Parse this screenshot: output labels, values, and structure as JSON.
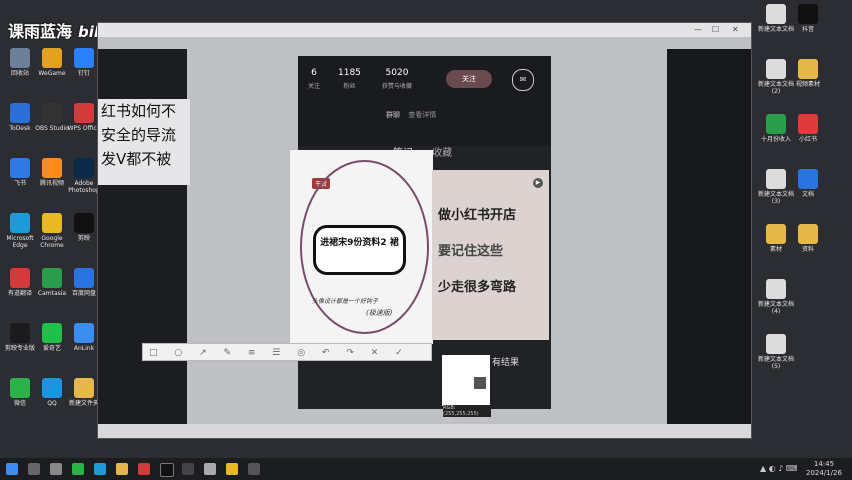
{
  "watermark": {
    "text": "课雨蓝海",
    "brand": "bilibili"
  },
  "window": {
    "title": "",
    "controls": [
      "—",
      "☐",
      "✕"
    ]
  },
  "profile": {
    "stats": [
      {
        "value": "6",
        "label": "关注"
      },
      {
        "value": "1185",
        "label": "粉丝"
      },
      {
        "value": "5020",
        "label": "获赞与收藏"
      }
    ],
    "follow_label": "关注",
    "group_text": "群聊",
    "group_link": "查看详情",
    "tabs": [
      "笔记",
      "收藏"
    ]
  },
  "left_text": [
    "红书如何不",
    "安全的导流",
    "发V都不被"
  ],
  "card_left": {
    "badge": "干货",
    "bubble_text": "进裙宋9份资料2 裙",
    "bottom_text": "头像设计都是一个好钩子",
    "signature": "(极速版)"
  },
  "card_right": {
    "lines": [
      "做小红书开店",
      "要记住这些",
      "少走很多弯路"
    ]
  },
  "under_text": "有结果",
  "picker": {
    "line1": "RGB: (255,255,255)",
    "line2": "HSB: 255,255,255"
  },
  "toolbar": {
    "tools": "□ ○ ↗ ✎ ≡ ☰ ◎ ↶ ↷ ✕ ✓"
  },
  "clock": {
    "time": "14:45",
    "date": "2024/1/26"
  },
  "desktop_left": [
    {
      "label": "回收站",
      "color": "#6e7f99"
    },
    {
      "label": "ToDesk",
      "color": "#2b6fd6"
    },
    {
      "label": "飞书",
      "color": "#2f7ae5"
    },
    {
      "label": "Microsoft Edge",
      "color": "#1e9ad6"
    },
    {
      "label": "有道翻译",
      "color": "#d23b3b"
    },
    {
      "label": "剪映专业版",
      "color": "#1b1b1b"
    },
    {
      "label": "微信",
      "color": "#2bb34a"
    },
    {
      "label": "WeGame",
      "color": "#e0a020"
    },
    {
      "label": "OBS Studio",
      "color": "#333"
    },
    {
      "label": "腾讯视频",
      "color": "#ff8a1e"
    },
    {
      "label": "Google Chrome",
      "color": "#e8b923"
    },
    {
      "label": "Camtasia",
      "color": "#2a9d4a"
    },
    {
      "label": "爱奇艺",
      "color": "#1fbf4a"
    },
    {
      "label": "QQ",
      "color": "#1a96e0"
    },
    {
      "label": "钉钉",
      "color": "#2a7fff"
    },
    {
      "label": "WPS Office",
      "color": "#d23b3b"
    },
    {
      "label": "Adobe Photoshop",
      "color": "#0b2a4a"
    },
    {
      "label": "剪映",
      "color": "#111"
    },
    {
      "label": "百度网盘",
      "color": "#2b73e0"
    },
    {
      "label": "AnLink",
      "color": "#3b8df0"
    },
    {
      "label": "新建文件夹",
      "color": "#e6b84a"
    }
  ],
  "desktop_right": [
    {
      "label": "新建文本文档",
      "color": "#dcdcdc"
    },
    {
      "label": "新建文本文档(2)",
      "color": "#dcdcdc"
    },
    {
      "label": "十月份收入",
      "color": "#2a9d4a"
    },
    {
      "label": "新建文本文档(3)",
      "color": "#dcdcdc"
    },
    {
      "label": "素材",
      "color": "#e6b84a"
    },
    {
      "label": "新建文本文档(4)",
      "color": "#dcdcdc"
    },
    {
      "label": "新建文本文档(5)",
      "color": "#dcdcdc"
    },
    {
      "label": "抖音",
      "color": "#111"
    },
    {
      "label": "视频素材",
      "color": "#e6b84a"
    },
    {
      "label": "小红书",
      "color": "#e03a3a"
    },
    {
      "label": "文档",
      "color": "#2b73e0"
    },
    {
      "label": "资料",
      "color": "#e6b84a"
    }
  ]
}
